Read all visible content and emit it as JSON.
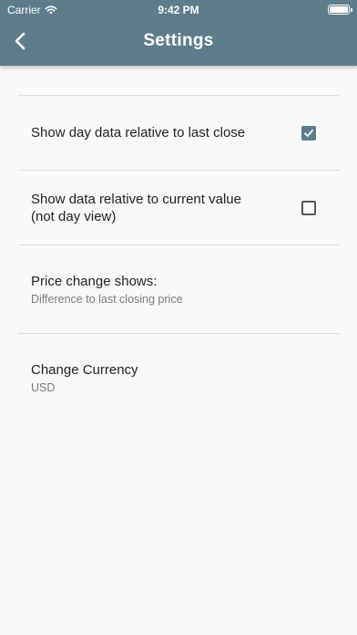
{
  "status_bar": {
    "carrier": "Carrier",
    "time": "9:42 PM",
    "icons": [
      "wifi-icon",
      "battery-icon"
    ]
  },
  "header": {
    "title": "Settings",
    "back_icon": "chevron-left-icon",
    "background_color": "#5e7d8c"
  },
  "settings": {
    "relative_last_close": {
      "label": "Show day data relative to last close",
      "checked": true
    },
    "relative_current_value": {
      "label_line1": "Show data relative to current value",
      "label_line2": "(not day view)",
      "checked": false
    },
    "price_change": {
      "label": "Price change shows:",
      "value": "Difference to last closing price"
    },
    "currency": {
      "label": "Change Currency",
      "value": "USD"
    }
  }
}
